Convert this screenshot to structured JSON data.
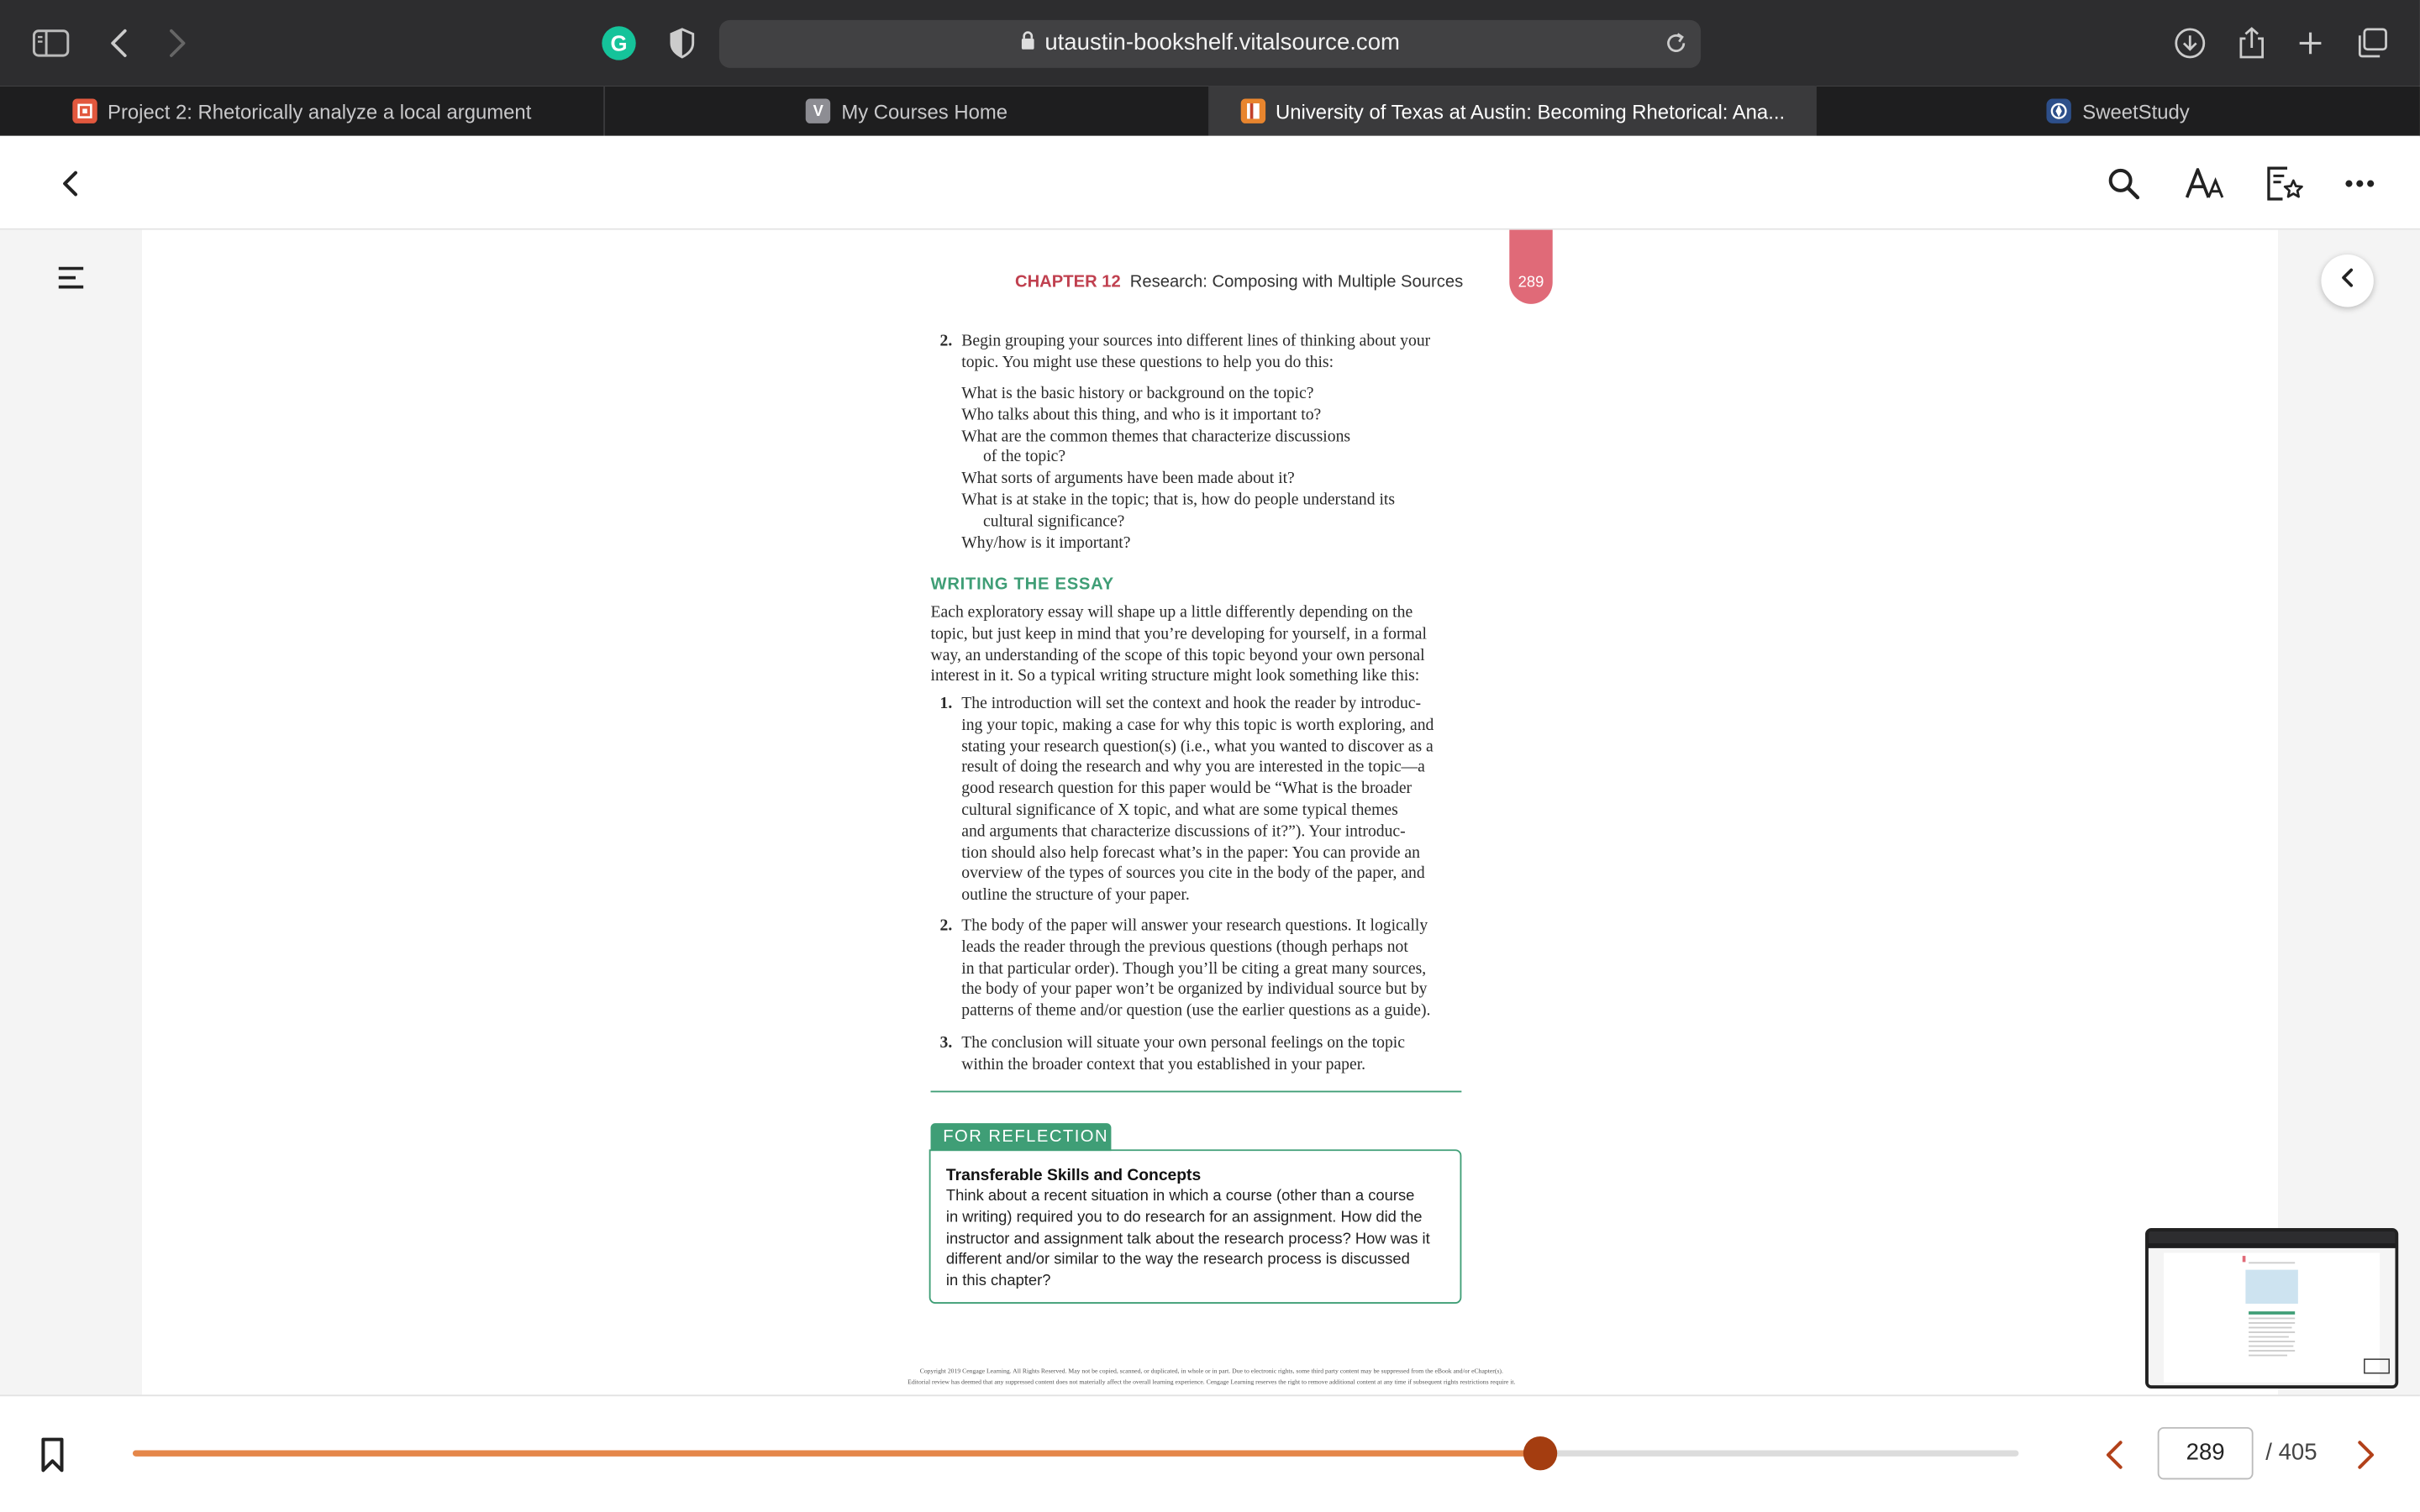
{
  "browser": {
    "url": "utaustin-bookshelf.vitalsource.com",
    "tabs": [
      {
        "label": "Project 2: Rhetorically analyze a local argument",
        "icon": "canvas-favicon"
      },
      {
        "label": "My Courses Home",
        "icon": "vitalsource-favicon",
        "glyph": "V"
      },
      {
        "label": "University of Texas at Austin: Becoming Rhetorical: Ana...",
        "icon": "bookshelf-favicon",
        "active": true
      },
      {
        "label": "SweetStudy",
        "icon": "sweetstudy-favicon"
      }
    ],
    "grammarly_glyph": "G"
  },
  "book": {
    "chapter_label": "CHAPTER 12",
    "chapter_title": "Research: Composing with Multiple Sources",
    "page_number": "289",
    "step2_number": "2.",
    "step2_lines": [
      "Begin grouping your sources into different lines of thinking about your",
      "topic. You might use these questions to help you do this:"
    ],
    "questions": [
      "What is the basic history or background on the topic?",
      "Who talks about this thing, and who is it important to?",
      "What are the common themes that characterize discussions",
      "of the topic?",
      "What sorts of arguments have been made about it?",
      "What is at stake in the topic; that is, how do people understand its",
      "cultural significance?",
      "Why/how is it important?"
    ],
    "section_heading": "WRITING THE ESSAY",
    "intro_lines": [
      "Each exploratory essay will shape up a little differently depending on the",
      "topic, but just keep in mind that you’re developing for yourself, in a formal",
      "way, an understanding of the scope of this topic beyond your own personal",
      "interest in it. So a typical writing structure might look something like this:"
    ],
    "list": [
      {
        "num": "1.",
        "lines": [
          "The introduction will set the context and hook the reader by introduc-",
          "ing your topic, making a case for why this topic is worth exploring, and",
          "stating your research question(s) (i.e., what you wanted to discover as a",
          "result of doing the research and why you are interested in the topic—a",
          "good research question for this paper would be “What is the broader",
          "cultural significance of X topic, and what are some typical themes",
          "and arguments that characterize discussions of it?”). Your introduc-",
          "tion should also help forecast what’s in the paper: You can provide an",
          "overview of the types of sources you cite in the body of the paper, and",
          "outline the structure of your paper."
        ]
      },
      {
        "num": "2.",
        "lines": [
          "The body of the paper will answer your research questions. It logically",
          "leads the reader through the previous questions (though perhaps not",
          "in that particular order). Though you’ll be citing a great many sources,",
          "the body of your paper won’t be organized by individual source but by",
          "patterns of theme and/or question (use the earlier questions as a guide)."
        ]
      },
      {
        "num": "3.",
        "lines": [
          "The conclusion will situate your own personal feelings on the topic",
          "within the broader context that you established in your paper."
        ]
      }
    ],
    "reflection": {
      "tab": "FOR REFLECTION",
      "title": "Transferable Skills and Concepts",
      "lines": [
        "Think about a recent situation in which a course (other than a course",
        "in writing) required you to do research for an assignment. How did the",
        "instructor and assignment talk about the research process? How was it",
        "different and/or similar to the way the research process is discussed",
        "in this chapter?"
      ]
    },
    "copyright_lines": [
      "Copyright 2019 Cengage Learning. All Rights Reserved. May not be copied, scanned, or duplicated, in whole or in part. Due to electronic rights, some third party content may be suppressed from the eBook and/or eChapter(s).",
      "Editorial review has deemed that any suppressed content does not materially affect the overall learning experience. Cengage Learning reserves the right to remove additional content at any time if subsequent rights restrictions require it."
    ]
  },
  "reader": {
    "current_page": "289",
    "total_pages": "/ 405",
    "progress": 0.746
  },
  "colors": {
    "accent_green": "#3f9e76",
    "chapter_red": "#c0404f",
    "progress_orange": "#e5874a",
    "knob": "#a43d10"
  }
}
